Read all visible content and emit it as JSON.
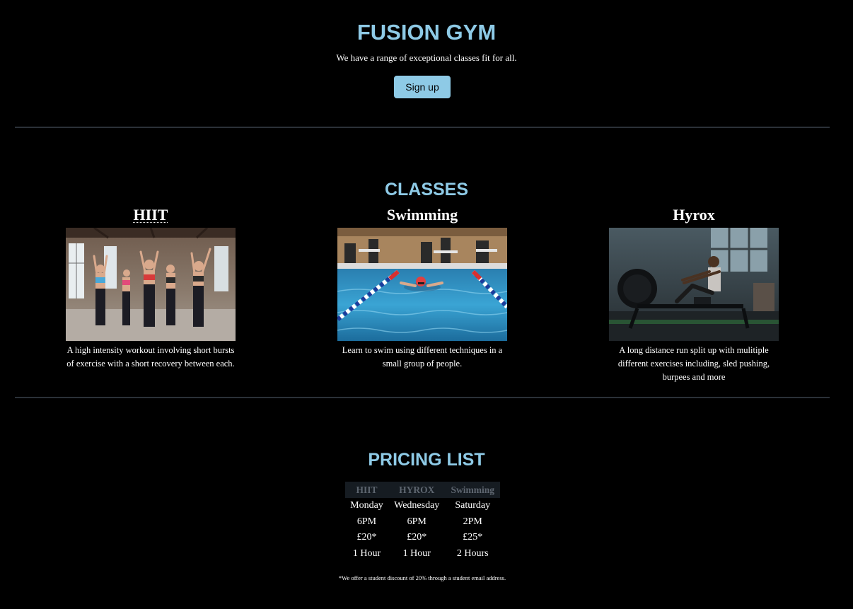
{
  "header": {
    "title": "FUSION GYM",
    "tagline": "We have a range of exceptional classes fit for all.",
    "signup_label": "Sign up"
  },
  "classes": {
    "title": "CLASSES",
    "items": [
      {
        "name": "HIIT",
        "description": "A high intensity workout involving short bursts of exercise with a short recovery between each."
      },
      {
        "name": "Swimming",
        "description": "Learn to swim using different techniques in a small group of people."
      },
      {
        "name": "Hyrox",
        "description": "A long distance run split up with mulitiple different exercises including, sled pushing, burpees and more"
      }
    ]
  },
  "pricing": {
    "title": "PRICING LIST",
    "headers": [
      "HIIT",
      "HYROX",
      "Swimming"
    ],
    "rows": [
      [
        "Monday",
        "Wednesday",
        "Saturday"
      ],
      [
        "6PM",
        "6PM",
        "2PM"
      ],
      [
        "£20*",
        "£20*",
        "£25*"
      ],
      [
        "1 Hour",
        "1 Hour",
        "2 Hours"
      ]
    ],
    "footnote": "*We offer a student discount of 20% through a student email address."
  },
  "colors": {
    "accent": "#8ecae6",
    "background": "#000000",
    "divider": "#2b3138",
    "table_header_bg": "#161c22"
  }
}
